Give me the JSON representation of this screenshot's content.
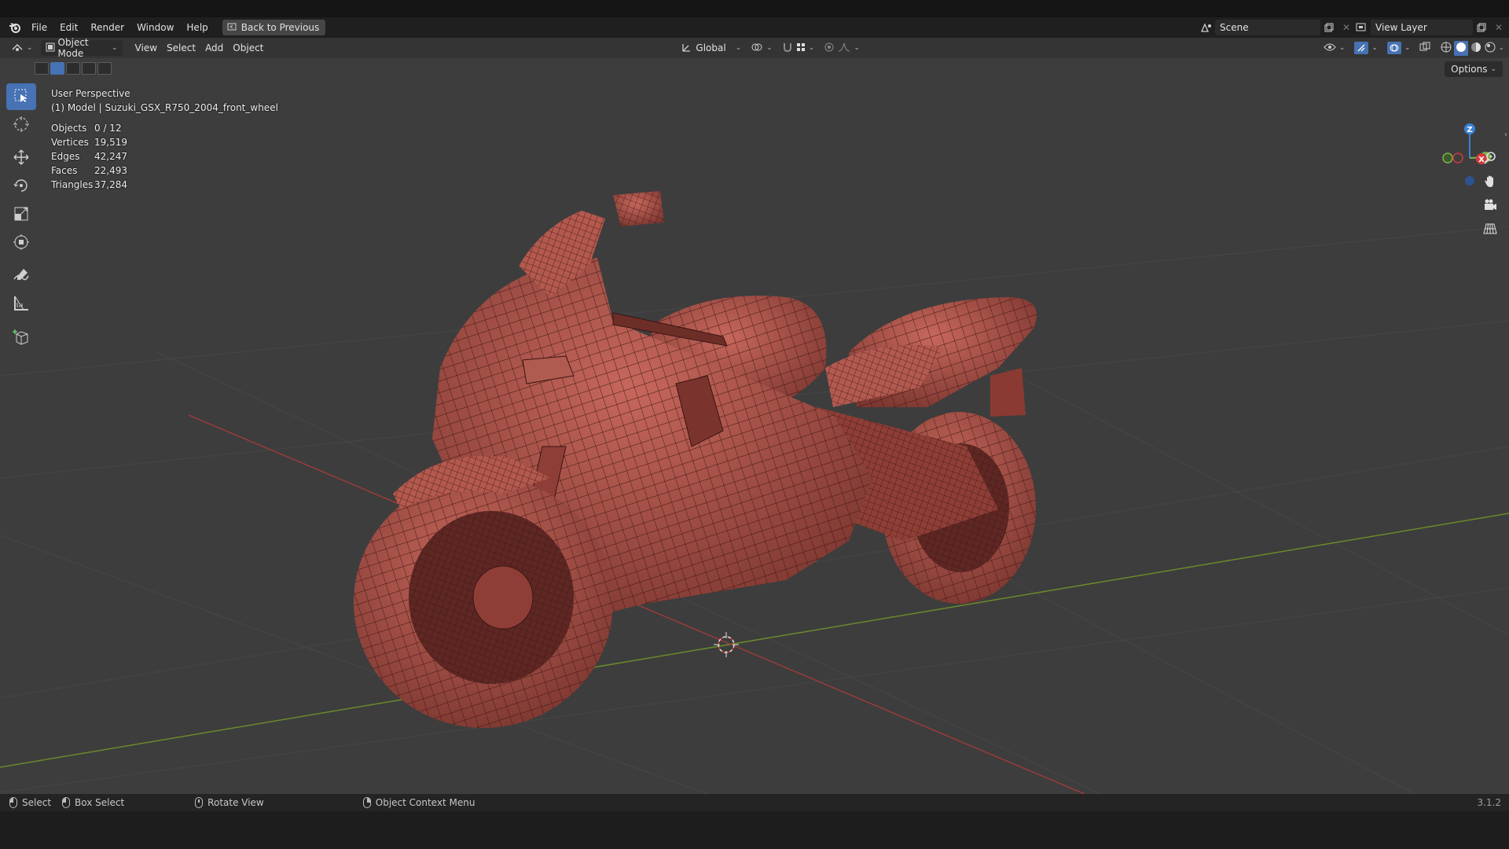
{
  "menu": {
    "items": [
      "File",
      "Edit",
      "Render",
      "Window",
      "Help"
    ],
    "back_button": "Back to Previous"
  },
  "scene": {
    "name": "Scene"
  },
  "view_layer": {
    "name": "View Layer"
  },
  "viewport_header": {
    "mode": "Object Mode",
    "menus": [
      "View",
      "Select",
      "Add",
      "Object"
    ],
    "orientation": "Global",
    "options": "Options"
  },
  "overlay": {
    "view_name": "User Perspective",
    "object_info": "(1) Model | Suzuki_GSX_R750_2004_front_wheel"
  },
  "stats": [
    {
      "label": "Objects",
      "value": "0 / 12"
    },
    {
      "label": "Vertices",
      "value": "19,519"
    },
    {
      "label": "Edges",
      "value": "42,247"
    },
    {
      "label": "Faces",
      "value": "22,493"
    },
    {
      "label": "Triangles",
      "value": "37,284"
    }
  ],
  "gizmo": {
    "z": "Z",
    "x": "X",
    "y": "Y"
  },
  "statusbar": {
    "select": "Select",
    "box_select": "Box Select",
    "rotate_view": "Rotate View",
    "context_menu": "Object Context Menu",
    "version": "3.1.2"
  },
  "colors": {
    "accent": "#4772b3",
    "model": "#a3524a",
    "grid_x": "#9a3b3b",
    "grid_y": "#6a8a2c",
    "viewport_bg": "#3d3d3d"
  }
}
